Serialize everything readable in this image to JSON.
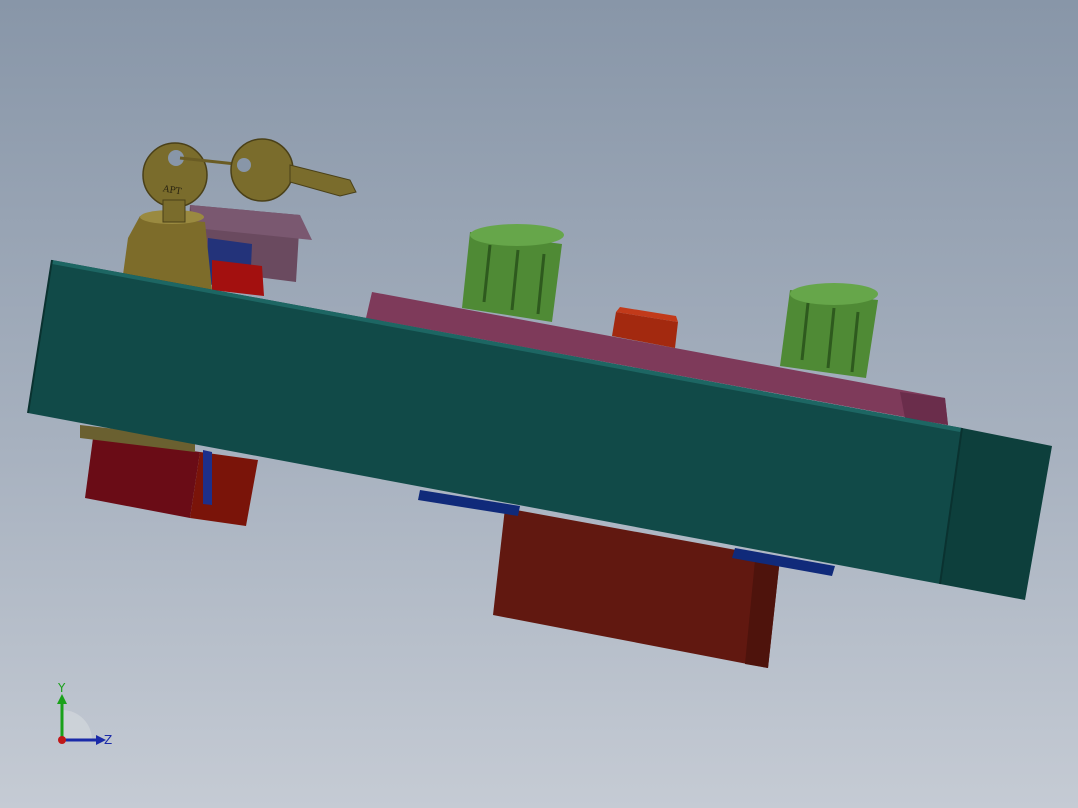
{
  "viewport": {
    "background_top": "#8896a8",
    "background_bottom": "#c5cbd4"
  },
  "model": {
    "key_engraving": "APT",
    "colors": {
      "enclosure": "#114a48",
      "enclosure_end": "#0d3f3c",
      "faceplate": "#7e3a5a",
      "knob": "#4f8a35",
      "button": "#a3290f",
      "keyswitch": "#7d6c2a",
      "key": "#7a6c2c",
      "estop_cap": "#6a4a5f",
      "relay": "#6a0c16",
      "relay_orange": "#7a1409",
      "bottom_block": "#611810",
      "rail": "#102a7a"
    }
  },
  "triad": {
    "y_label": "Y",
    "z_label": "Z",
    "y_color": "#1aa11a",
    "z_color": "#1a2aa8",
    "origin_color": "#c01818"
  }
}
